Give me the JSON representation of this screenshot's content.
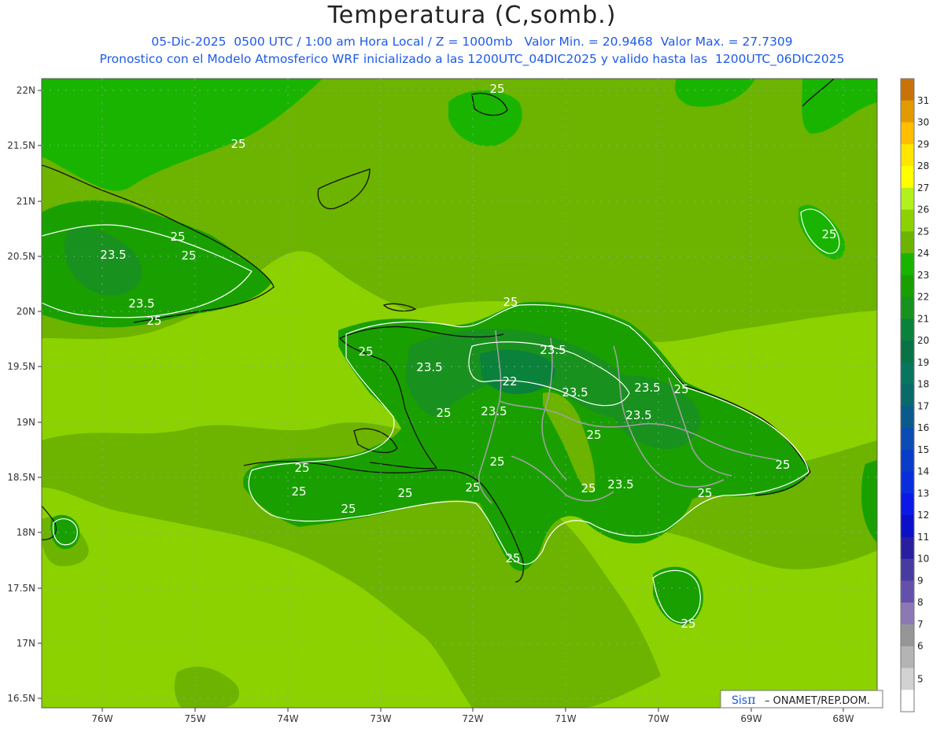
{
  "header": {
    "title": "Temperatura (C,somb.)",
    "line1": "05-Dic-2025  0500 UTC / 1:00 am Hora Local / Z = 1000mb   Valor Min. = 20.9468  Valor Max. = 27.7309",
    "line2": "Pronostico con el Modelo Atmosferico WRF inicializado a las 1200UTC_04DIC2025 y valido hasta las  1200UTC_06DIC2025"
  },
  "axes": {
    "lat_labels": [
      "22N",
      "21.5N",
      "21N",
      "20.5N",
      "20N",
      "19.5N",
      "19N",
      "18.5N",
      "18N",
      "17.5N",
      "17N",
      "16.5N"
    ],
    "lon_labels": [
      "76W",
      "75W",
      "74W",
      "73W",
      "72W",
      "71W",
      "70W",
      "69W",
      "68W"
    ]
  },
  "colorbar": {
    "labels": [
      "31",
      "30",
      "29",
      "28",
      "27",
      "26",
      "25",
      "24",
      "23",
      "22",
      "21",
      "20",
      "19",
      "18",
      "17",
      "16",
      "15",
      "14",
      "13",
      "12",
      "11",
      "10",
      "9",
      "8",
      "7",
      "6",
      "5"
    ],
    "colors": [
      "#c8730a",
      "#e19a00",
      "#ffbf00",
      "#ffe600",
      "#ffff00",
      "#b2f01e",
      "#8cd200",
      "#6cb400",
      "#19b400",
      "#19a000",
      "#19911e",
      "#0a823c",
      "#0a7346",
      "#08765e",
      "#0a6a6a",
      "#0a5a8c",
      "#0a4bb4",
      "#0a3cc8",
      "#0a2ddc",
      "#0a19e6",
      "#0a0fc8",
      "#281ea0",
      "#463ca0",
      "#6450aa",
      "#8c78b4",
      "#969696",
      "#b4b4b4",
      "#d2d2d2",
      "#ffffff"
    ]
  },
  "contour_labels": [
    {
      "text": "25"
    },
    {
      "text": "25"
    },
    {
      "text": "25"
    },
    {
      "text": "23.5"
    },
    {
      "text": "23.5"
    },
    {
      "text": "25"
    },
    {
      "text": "25"
    },
    {
      "text": "25"
    },
    {
      "text": "23.5"
    },
    {
      "text": "23.5"
    },
    {
      "text": "22"
    },
    {
      "text": "23.5"
    },
    {
      "text": "25"
    },
    {
      "text": "23.5"
    },
    {
      "text": "23.5"
    },
    {
      "text": "25"
    },
    {
      "text": "23.5"
    },
    {
      "text": "25"
    },
    {
      "text": "25"
    },
    {
      "text": "25"
    },
    {
      "text": "25"
    },
    {
      "text": "25"
    },
    {
      "text": "25"
    },
    {
      "text": "25"
    },
    {
      "text": "25"
    },
    {
      "text": "23.5"
    },
    {
      "text": "25"
    },
    {
      "text": "25"
    },
    {
      "text": "25"
    },
    {
      "text": "25"
    },
    {
      "text": "25"
    },
    {
      "text": "25"
    }
  ],
  "credit": {
    "brand": "SisPI",
    "text": "– ONAMET/REP.DOM."
  }
}
